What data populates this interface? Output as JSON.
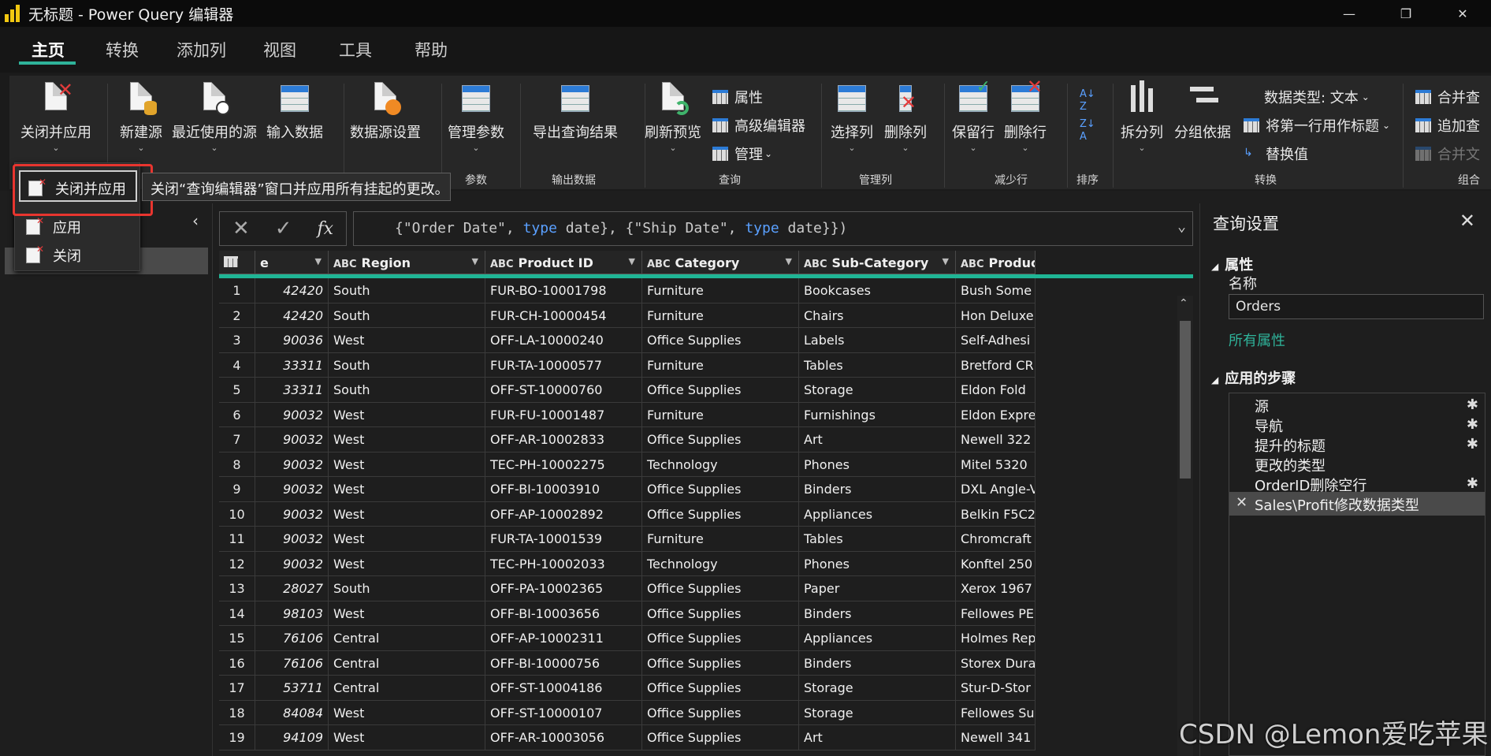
{
  "window": {
    "title": "无标题 - Power Query 编辑器",
    "controls": {
      "minimize": "—",
      "restore": "❐",
      "close": "✕"
    }
  },
  "menu_tabs": [
    "主页",
    "转换",
    "添加列",
    "视图",
    "工具",
    "帮助"
  ],
  "ribbon": {
    "close_apply": "关闭并应用",
    "new_source": "新建源",
    "recent_sources": "最近使用的源",
    "enter_data": "输入数据",
    "data_source_settings": "数据源设置",
    "manage_params": "管理参数",
    "export_results": "导出查询结果",
    "refresh_preview": "刷新预览",
    "properties": "属性",
    "advanced_editor": "高级编辑器",
    "manage": "管理",
    "choose_columns": "选择列",
    "remove_columns": "删除列",
    "keep_rows": "保留行",
    "remove_rows": "删除行",
    "split_column": "拆分列",
    "group_by": "分组依据",
    "data_type": "数据类型: 文本",
    "first_row_header": "将第一行用作标题",
    "replace_values": "替换值",
    "merge": "合并查",
    "append": "追加查",
    "combine": "合并文",
    "groups": {
      "params": "参数",
      "output": "输出数据",
      "query": "查询",
      "manage_cols": "管理列",
      "reduce_rows": "减少行",
      "sort": "排序",
      "transform": "转换",
      "combine": "组合"
    }
  },
  "dropdown": {
    "items": [
      "关闭并应用",
      "应用",
      "关闭"
    ],
    "tooltip": "关闭“查询编辑器”窗口并应用所有挂起的更改。"
  },
  "formula": {
    "p1": "{\"Order Date\", ",
    "kw1": "type",
    "p2": " date}, {\"Ship Date\", ",
    "kw2": "type",
    "p3": " date}})"
  },
  "grid": {
    "columns": [
      "e",
      "Region",
      "Product ID",
      "Category",
      "Sub-Category",
      "Product N"
    ],
    "rows": [
      [
        "1",
        "42420",
        "South",
        "FUR-BO-10001798",
        "Furniture",
        "Bookcases",
        "Bush Some"
      ],
      [
        "2",
        "42420",
        "South",
        "FUR-CH-10000454",
        "Furniture",
        "Chairs",
        "Hon Deluxe"
      ],
      [
        "3",
        "90036",
        "West",
        "OFF-LA-10000240",
        "Office Supplies",
        "Labels",
        "Self-Adhesi"
      ],
      [
        "4",
        "33311",
        "South",
        "FUR-TA-10000577",
        "Furniture",
        "Tables",
        "Bretford CR"
      ],
      [
        "5",
        "33311",
        "South",
        "OFF-ST-10000760",
        "Office Supplies",
        "Storage",
        "Eldon Fold"
      ],
      [
        "6",
        "90032",
        "West",
        "FUR-FU-10001487",
        "Furniture",
        "Furnishings",
        "Eldon Expre"
      ],
      [
        "7",
        "90032",
        "West",
        "OFF-AR-10002833",
        "Office Supplies",
        "Art",
        "Newell 322"
      ],
      [
        "8",
        "90032",
        "West",
        "TEC-PH-10002275",
        "Technology",
        "Phones",
        "Mitel 5320"
      ],
      [
        "9",
        "90032",
        "West",
        "OFF-BI-10003910",
        "Office Supplies",
        "Binders",
        "DXL Angle-V"
      ],
      [
        "10",
        "90032",
        "West",
        "OFF-AP-10002892",
        "Office Supplies",
        "Appliances",
        "Belkin F5C2"
      ],
      [
        "11",
        "90032",
        "West",
        "FUR-TA-10001539",
        "Furniture",
        "Tables",
        "Chromcraft"
      ],
      [
        "12",
        "90032",
        "West",
        "TEC-PH-10002033",
        "Technology",
        "Phones",
        "Konftel 250"
      ],
      [
        "13",
        "28027",
        "South",
        "OFF-PA-10002365",
        "Office Supplies",
        "Paper",
        "Xerox 1967"
      ],
      [
        "14",
        "98103",
        "West",
        "OFF-BI-10003656",
        "Office Supplies",
        "Binders",
        "Fellowes PE"
      ],
      [
        "15",
        "76106",
        "Central",
        "OFF-AP-10002311",
        "Office Supplies",
        "Appliances",
        "Holmes Rep"
      ],
      [
        "16",
        "76106",
        "Central",
        "OFF-BI-10000756",
        "Office Supplies",
        "Binders",
        "Storex Dura"
      ],
      [
        "17",
        "53711",
        "Central",
        "OFF-ST-10004186",
        "Office Supplies",
        "Storage",
        "Stur-D-Stor"
      ],
      [
        "18",
        "84084",
        "West",
        "OFF-ST-10000107",
        "Office Supplies",
        "Storage",
        "Fellowes Su"
      ],
      [
        "19",
        "94109",
        "West",
        "OFF-AR-10003056",
        "Office Supplies",
        "Art",
        "Newell 341"
      ]
    ]
  },
  "settings": {
    "title": "查询设置",
    "properties_header": "属性",
    "name_label": "名称",
    "name_value": "Orders",
    "all_properties": "所有属性",
    "steps_header": "应用的步骤",
    "steps": [
      "源",
      "导航",
      "提升的标题",
      "更改的类型",
      "OrderID删除空行",
      "Sales\\Profit修改数据类型"
    ]
  },
  "watermark": "CSDN @Lemon爱吃苹果",
  "colors": {
    "accent": "#2fb39a",
    "highlight": "#e8352f",
    "keyword": "#5aa0ff"
  }
}
